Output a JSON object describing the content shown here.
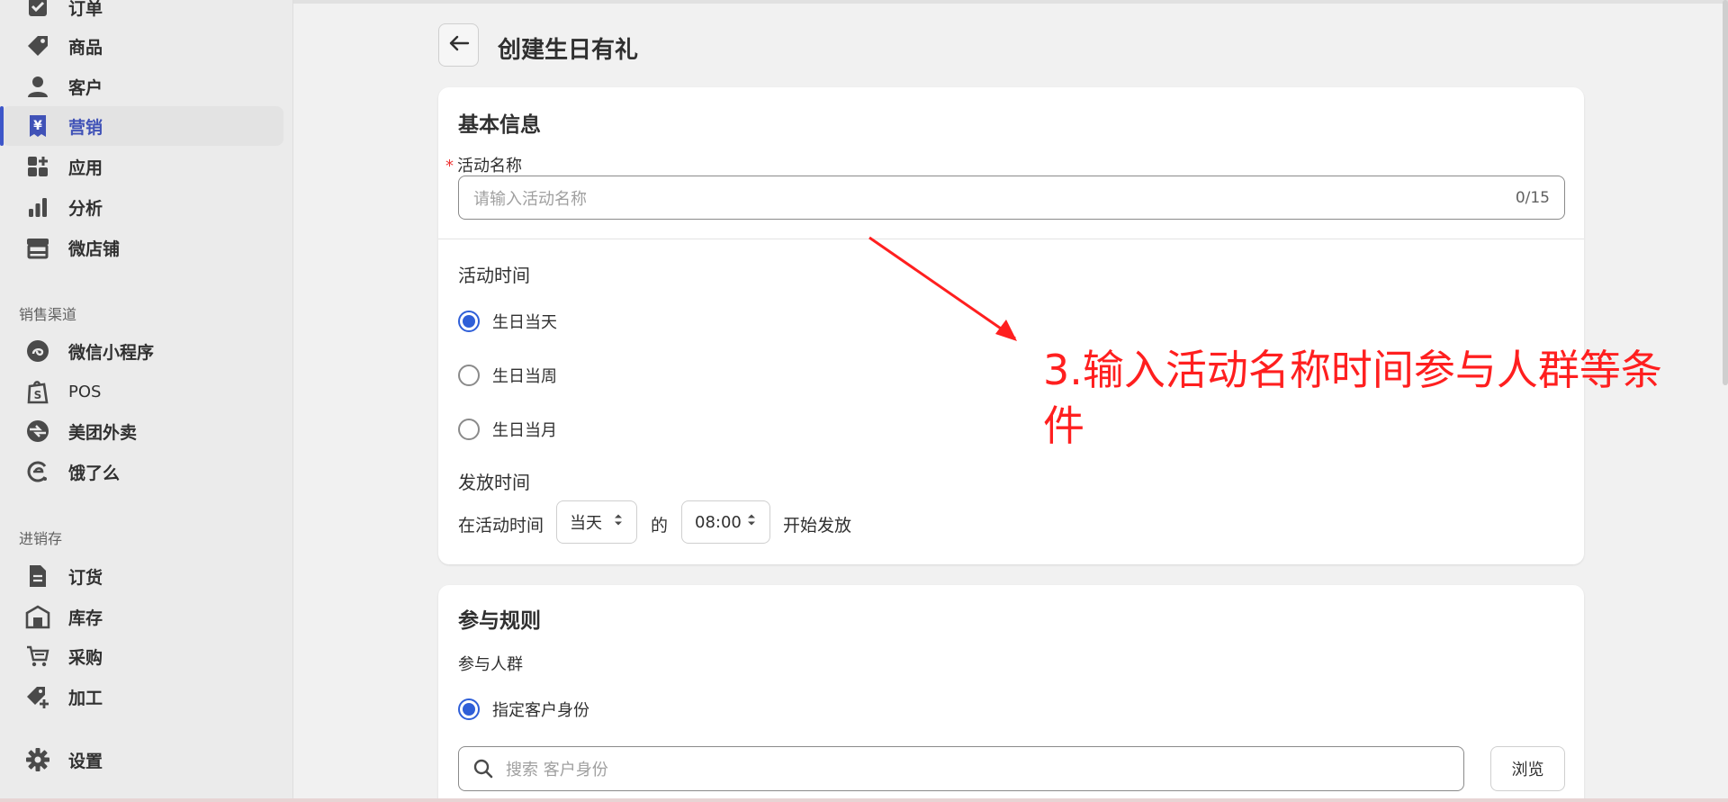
{
  "sidebar": {
    "items": [
      {
        "label": "订单",
        "icon": "order-icon"
      },
      {
        "label": "商品",
        "icon": "tag-icon"
      },
      {
        "label": "客户",
        "icon": "person-icon"
      },
      {
        "label": "营销",
        "icon": "yen-icon",
        "active": true
      },
      {
        "label": "应用",
        "icon": "apps-icon"
      },
      {
        "label": "分析",
        "icon": "bar-chart-icon"
      },
      {
        "label": "微店铺",
        "icon": "store-icon"
      }
    ],
    "sales_channels_title": "销售渠道",
    "sales_channels": [
      {
        "label": "微信小程序",
        "icon": "mini-program-icon"
      },
      {
        "label": "POS",
        "icon": "pos-bag-icon"
      },
      {
        "label": "美团外卖",
        "icon": "meituan-icon"
      },
      {
        "label": "饿了么",
        "icon": "eleme-icon"
      }
    ],
    "inventory_title": "进销存",
    "inventory": [
      {
        "label": "订货",
        "icon": "document-icon"
      },
      {
        "label": "库存",
        "icon": "warehouse-icon"
      },
      {
        "label": "采购",
        "icon": "cart-icon"
      },
      {
        "label": "加工",
        "icon": "tag-plus-icon"
      }
    ],
    "settings_label": "设置"
  },
  "header": {
    "title": "创建生日有礼"
  },
  "basic_info": {
    "title": "基本信息",
    "name_label": "活动名称",
    "name_placeholder": "请输入活动名称",
    "name_counter": "0/15",
    "time_label": "活动时间",
    "time_options": [
      "生日当天",
      "生日当周",
      "生日当月"
    ],
    "time_selected": 0,
    "issue_label": "发放时间",
    "issue_prefix": "在活动时间",
    "issue_day": "当天",
    "issue_of": "的",
    "issue_time": "08:00",
    "issue_suffix": "开始发放"
  },
  "rules": {
    "title": "参与规则",
    "crowd_label": "参与人群",
    "crowd_option": "指定客户身份",
    "search_placeholder": "搜索 客户身份",
    "browse_label": "浏览"
  },
  "annotation": {
    "text": "3.输入活动名称时间参与人群等条件"
  },
  "colors": {
    "accent": "#2f5fd8",
    "active_nav": "#4052b7",
    "annotation": "#ff1f1f"
  }
}
